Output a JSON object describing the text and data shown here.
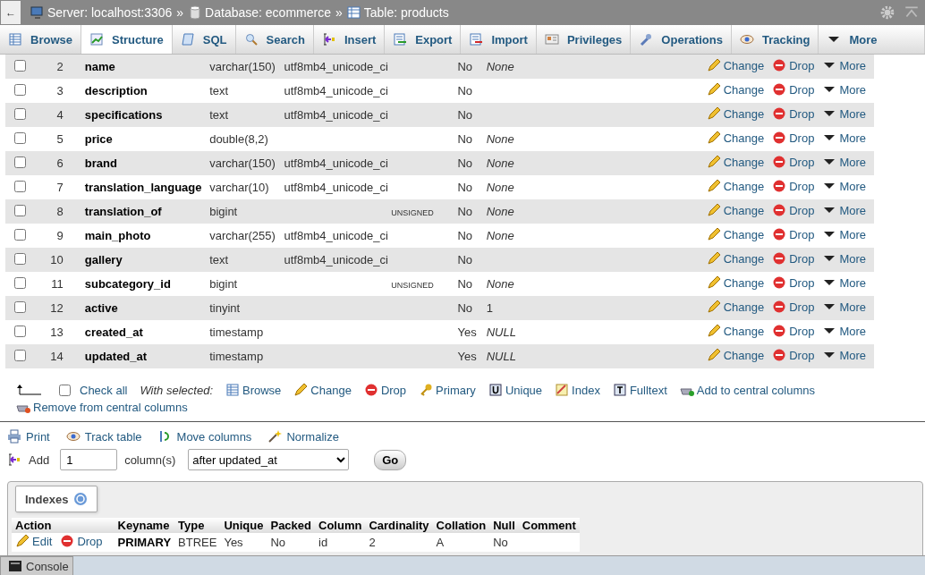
{
  "top_bar": {
    "back": "←",
    "crumbs": [
      {
        "label": "Server: localhost:3306",
        "separator": "»"
      },
      {
        "label": "Database: ecommerce",
        "separator": "»"
      },
      {
        "label": "Table: products"
      }
    ]
  },
  "tabs": [
    {
      "label": "Browse",
      "selected": false
    },
    {
      "label": "Structure",
      "selected": true
    },
    {
      "label": "SQL",
      "selected": false
    },
    {
      "label": "Search",
      "selected": false
    },
    {
      "label": "Insert",
      "selected": false
    },
    {
      "label": "Export",
      "selected": false
    },
    {
      "label": "Import",
      "selected": false
    },
    {
      "label": "Privileges",
      "selected": false
    },
    {
      "label": "Operations",
      "selected": false
    },
    {
      "label": "Tracking",
      "selected": false
    },
    {
      "label": "More",
      "selected": false
    }
  ],
  "columns": [
    {
      "num": "2",
      "name": "name",
      "type": "varchar(150)",
      "collation": "utf8mb4_unicode_ci",
      "null": "No",
      "default": "None",
      "default_italic": true,
      "checked": false,
      "actions": [
        "Change",
        "Drop",
        "More"
      ]
    },
    {
      "num": "3",
      "name": "description",
      "type": "text",
      "collation": "utf8mb4_unicode_ci",
      "null": "No",
      "checked": false,
      "actions": [
        "Change",
        "Drop",
        "More"
      ]
    },
    {
      "num": "4",
      "name": "specifications",
      "type": "text",
      "collation": "utf8mb4_unicode_ci",
      "null": "No",
      "checked": false,
      "actions": [
        "Change",
        "Drop",
        "More"
      ]
    },
    {
      "num": "5",
      "name": "price",
      "type": "double(8,2)",
      "null": "No",
      "default": "None",
      "default_italic": true,
      "checked": false,
      "actions": [
        "Change",
        "Drop",
        "More"
      ]
    },
    {
      "num": "6",
      "name": "brand",
      "type": "varchar(150)",
      "collation": "utf8mb4_unicode_ci",
      "null": "No",
      "default": "None",
      "default_italic": true,
      "checked": false,
      "actions": [
        "Change",
        "Drop",
        "More"
      ]
    },
    {
      "num": "7",
      "name": "translation_language",
      "type": "varchar(10)",
      "collation": "utf8mb4_unicode_ci",
      "null": "No",
      "default": "None",
      "default_italic": true,
      "checked": false,
      "actions": [
        "Change",
        "Drop",
        "More"
      ]
    },
    {
      "num": "8",
      "name": "translation_of",
      "type": "bigint",
      "attributes": "UNSIGNED",
      "null": "No",
      "default": "None",
      "default_italic": true,
      "checked": false,
      "actions": [
        "Change",
        "Drop",
        "More"
      ]
    },
    {
      "num": "9",
      "name": "main_photo",
      "type": "varchar(255)",
      "collation": "utf8mb4_unicode_ci",
      "null": "No",
      "default": "None",
      "default_italic": true,
      "checked": false,
      "actions": [
        "Change",
        "Drop",
        "More"
      ]
    },
    {
      "num": "10",
      "name": "gallery",
      "type": "text",
      "collation": "utf8mb4_unicode_ci",
      "null": "No",
      "checked": false,
      "actions": [
        "Change",
        "Drop",
        "More"
      ]
    },
    {
      "num": "11",
      "name": "subcategory_id",
      "type": "bigint",
      "attributes": "UNSIGNED",
      "null": "No",
      "default": "None",
      "default_italic": true,
      "checked": false,
      "actions": [
        "Change",
        "Drop",
        "More"
      ]
    },
    {
      "num": "12",
      "name": "active",
      "type": "tinyint",
      "null": "No",
      "default": "1",
      "default_italic": false,
      "checked": false,
      "actions": [
        "Change",
        "Drop",
        "More"
      ]
    },
    {
      "num": "13",
      "name": "created_at",
      "type": "timestamp",
      "null": "Yes",
      "default": "NULL",
      "default_italic": true,
      "checked": false,
      "actions": [
        "Change",
        "Drop",
        "More"
      ]
    },
    {
      "num": "14",
      "name": "updated_at",
      "type": "timestamp",
      "null": "Yes",
      "default": "NULL",
      "default_italic": true,
      "checked": false,
      "actions": [
        "Change",
        "Drop",
        "More"
      ]
    }
  ],
  "bulk": {
    "check_all": "Check all",
    "checked": false,
    "with_selected": "With selected:",
    "actions": [
      "Browse",
      "Change",
      "Drop",
      "Primary",
      "Unique",
      "Index",
      "Fulltext",
      "Add to central columns",
      "Remove from central columns"
    ]
  },
  "tools": [
    "Print",
    "Track table",
    "Move columns",
    "Normalize"
  ],
  "add_column": {
    "label": "Add",
    "count": "1",
    "unit": "column(s)",
    "position": "after updated_at",
    "button": "Go"
  },
  "indexes": {
    "title": "Indexes",
    "columns": [
      "Action",
      "Keyname",
      "Type",
      "Unique",
      "Packed",
      "Column",
      "Cardinality",
      "Collation",
      "Null",
      "Comment"
    ],
    "rows": [
      {
        "actions": [
          "Edit",
          "Drop"
        ],
        "keyname": "PRIMARY",
        "type": "BTREE",
        "unique": "Yes",
        "packed": "No",
        "column": "id",
        "cardinality": "2",
        "collation": "A",
        "null": "No"
      }
    ]
  },
  "console": {
    "label": "Console"
  }
}
